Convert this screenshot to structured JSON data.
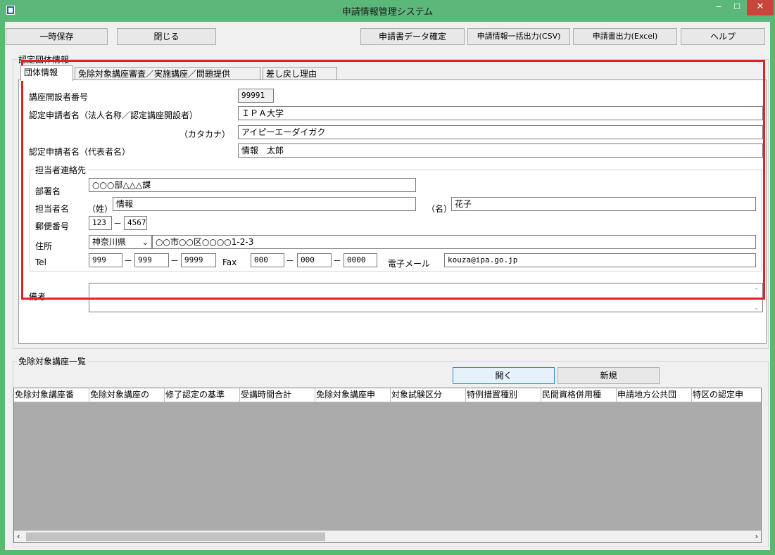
{
  "window": {
    "title": "申請情報管理システム"
  },
  "toolbar": {
    "temp_save": "一時保存",
    "close": "閉じる",
    "confirm_data": "申請書データ確定",
    "bulk_csv": "申請情報一括出力(CSV)",
    "excel_output": "申請書出力(Excel)",
    "help": "ヘルプ"
  },
  "org_group_label": "認定団体情報",
  "tabs": [
    {
      "label": "団体情報"
    },
    {
      "label": "免除対象講座審査／実施講座／問題提供"
    },
    {
      "label": "差し戻し理由"
    }
  ],
  "form": {
    "lecture_opener_no_label": "講座開設者番号",
    "lecture_opener_no": "99991",
    "applicant_name_label": "認定申請者名（法人名称／認定講座開設者）",
    "applicant_name": "ＩＰＡ大学",
    "katakana_label": "（カタカナ）",
    "katakana": "アイピーエーダイガク",
    "representative_label": "認定申請者名（代表者名）",
    "representative": "情報　太郎",
    "contact_group_label": "担当者連絡先",
    "dept_label": "部署名",
    "dept": "○○○部△△△課",
    "person_label": "担当者名",
    "surname_label": "（姓）",
    "surname": "情報",
    "given_label": "（名）",
    "given": "花子",
    "postal_label": "郵便番号",
    "postal1": "123",
    "postal2": "4567",
    "address_label": "住所",
    "prefecture": "神奈川県",
    "address": "○○市○○区○○○○1-2-3",
    "tel_label": "Tel",
    "tel1": "999",
    "tel2": "999",
    "tel3": "9999",
    "fax_label": "Fax",
    "fax1": "000",
    "fax2": "000",
    "fax3": "0000",
    "email_label": "電子メール",
    "email": "kouza@ipa.go.jp",
    "remarks_label": "備考",
    "remarks": "",
    "dash": "－"
  },
  "course_list": {
    "label": "免除対象講座一覧",
    "open_button": "開く",
    "new_button": "新規",
    "columns": [
      "免除対象講座番",
      "免除対象講座の",
      "修了認定の基準",
      "受講時間合計",
      "免除対象講座申",
      "対象試験区分",
      "特例措置種別",
      "民間資格併用種",
      "申請地方公共団",
      "特区の認定申"
    ]
  }
}
